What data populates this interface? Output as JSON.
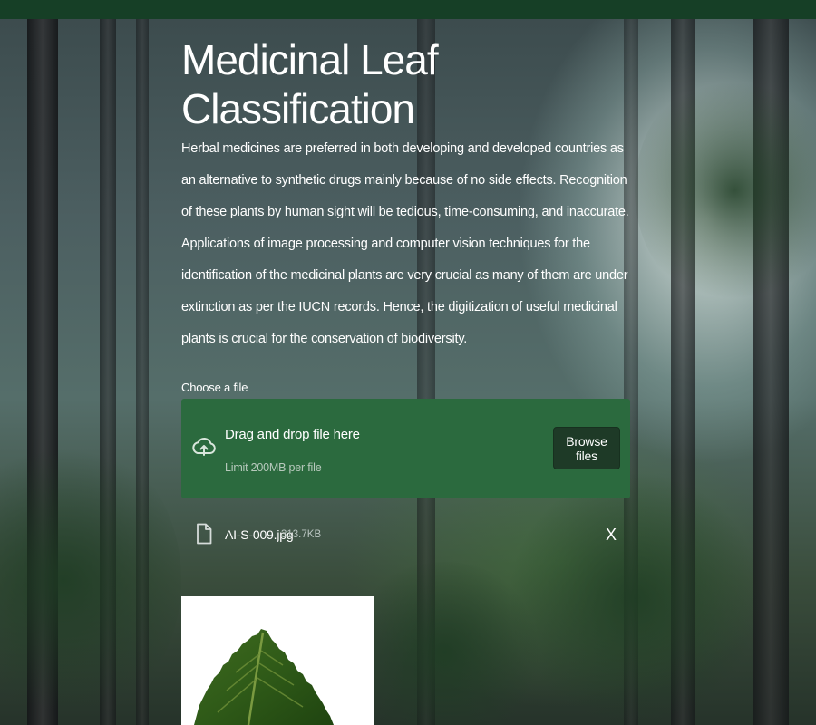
{
  "page": {
    "title": "Medicinal Leaf Classification",
    "paragraphs": [
      "Herbal medicines are preferred in both developing and developed countries as an alternative to synthetic drugs mainly because of no side effects. Recognition of these plants by human sight will be tedious, time-consuming, and inaccurate.",
      "Applications of image processing and computer vision techniques for the identification of the medicinal plants are very crucial as many of them are under extinction as per the IUCN records. Hence, the digitization of useful medicinal plants is crucial for the conservation of biodiversity."
    ]
  },
  "uploader": {
    "label": "Choose a file",
    "drag_text": "Drag and drop file here",
    "limit_text": "Limit 200MB per file",
    "browse_label": "Browse files",
    "icon": "cloud-upload-icon"
  },
  "uploaded_file": {
    "name": "AI-S-009.jpg",
    "size": "313.7KB",
    "remove_label": "X",
    "icon": "file-icon"
  },
  "preview": {
    "icon": "leaf-image"
  },
  "colors": {
    "header": "#163f26",
    "uploader_bg": "#2b6a3e",
    "browse_button": "#1e3a27",
    "text": "#ffffff"
  }
}
